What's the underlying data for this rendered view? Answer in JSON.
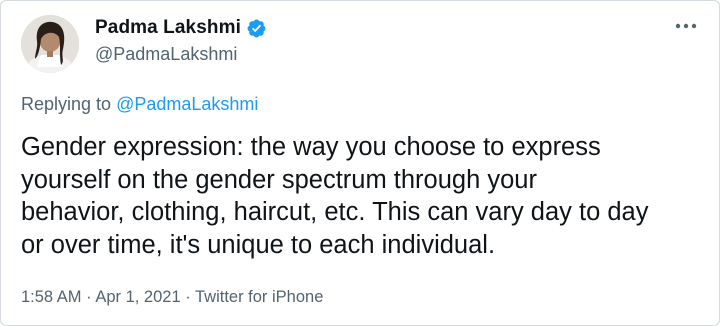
{
  "user": {
    "display_name": "Padma Lakshmi",
    "handle": "@PadmaLakshmi",
    "verified": true,
    "avatar_icon": "profile-photo",
    "verified_icon": "verified-badge-icon",
    "verified_color": "#1d9bf0"
  },
  "more_icon": "more-options-icon",
  "reply": {
    "prefix": "Replying to ",
    "mention": "@PadmaLakshmi"
  },
  "tweet": {
    "lines": [
      "Gender expression: the way you choose to express",
      "yourself on the gender spectrum through your",
      "behavior, clothing, haircut, etc. This can vary day to day",
      "or over time, it's unique to each individual."
    ]
  },
  "meta": {
    "time": "1:58 AM",
    "separator": " · ",
    "date": "Apr 1, 2021",
    "source": "Twitter for iPhone"
  },
  "colors": {
    "text": "#0f1419",
    "secondary": "#536471",
    "link": "#1d9bf0",
    "border": "#d5dbe0"
  }
}
